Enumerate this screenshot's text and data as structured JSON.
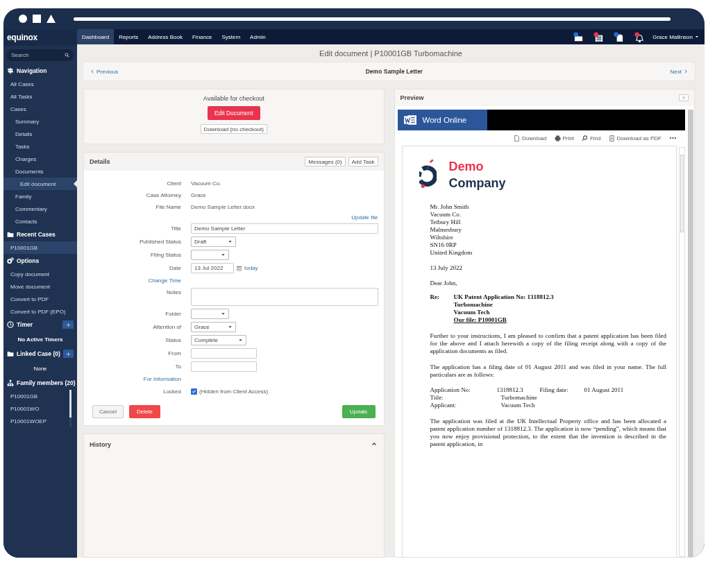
{
  "sidebar": {
    "logo": "equinox",
    "search": {
      "placeholder": "Search"
    },
    "sections": [
      {
        "title": "Navigation",
        "add_button": false,
        "scrollable": false,
        "items": [
          {
            "label": "All Cases",
            "selected": false
          },
          {
            "label": "All Tasks",
            "selected": false
          },
          {
            "label": "Cases",
            "selected": false,
            "children": [
              {
                "label": "Summary",
                "selected": false
              },
              {
                "label": "Details",
                "selected": false
              },
              {
                "label": "Tasks",
                "selected": false
              },
              {
                "label": "Charges",
                "selected": false
              },
              {
                "label": "Documents",
                "selected": false,
                "children": [
                  {
                    "label": "Edit document",
                    "selected": true
                  }
                ]
              },
              {
                "label": "Family",
                "selected": false
              },
              {
                "label": "Commentary",
                "selected": false
              },
              {
                "label": "Contacts",
                "selected": false
              }
            ]
          }
        ]
      },
      {
        "title": "Recent Cases",
        "add_button": false,
        "scrollable": false,
        "items": [
          {
            "label": "P10001GB",
            "selected": true
          }
        ]
      },
      {
        "title": "Options",
        "add_button": false,
        "scrollable": false,
        "items": [
          {
            "label": "Copy document",
            "selected": false
          },
          {
            "label": "Move document",
            "selected": false
          },
          {
            "label": "Convert to PDF",
            "selected": false
          },
          {
            "label": "Convert to PDF (EPO)",
            "selected": false
          }
        ]
      },
      {
        "title": "Timer",
        "add_button": true,
        "scrollable": false,
        "note": "No Active Timers"
      },
      {
        "title": "Linked Case (0)",
        "add_button": true,
        "scrollable": false,
        "note": "None"
      },
      {
        "title": "Family members (20)",
        "add_button": false,
        "scrollable": true,
        "items": [
          {
            "label": "P10001GB",
            "selected": false
          },
          {
            "label": "P10001WO",
            "selected": false
          },
          {
            "label": "P10001WOEP",
            "selected": false
          }
        ]
      }
    ]
  },
  "topnav": {
    "tabs": [
      {
        "label": "Dashboard",
        "selected": true
      },
      {
        "label": "Reports",
        "selected": false
      },
      {
        "label": "Address Book",
        "selected": false
      },
      {
        "label": "Finance",
        "selected": false
      },
      {
        "label": "System",
        "selected": false
      },
      {
        "label": "Admin",
        "selected": false
      }
    ],
    "user": "Grace Mallinson"
  },
  "page_title": "Edit document | P10001GB Turbomachine",
  "pager": {
    "previous": "Previous",
    "title": "Demo Sample Letter",
    "next": "Next"
  },
  "checkout": {
    "status": "Available for checkout",
    "edit_button": "Edit Document",
    "download_button": "Download (no checkout)"
  },
  "details": {
    "title": "Details",
    "header_buttons": [
      "Messages (0)",
      "Add Task"
    ],
    "fields": [
      {
        "kind": "text",
        "label": "Client",
        "value": "Vacuum Co."
      },
      {
        "kind": "text",
        "label": "Case Attorney",
        "value": "Grace"
      },
      {
        "kind": "text",
        "label": "File Name",
        "value": "Demo Sample Letter.docx"
      },
      {
        "kind": "right_link",
        "label": "Update file"
      },
      {
        "kind": "input",
        "label": "Title",
        "value": "Demo Sample Letter"
      },
      {
        "kind": "select",
        "label": "Published Status",
        "value": "Draft"
      },
      {
        "kind": "select",
        "label": "Filing Status"
      },
      {
        "kind": "date",
        "label": "Date",
        "value": "13 Jul 2022",
        "link": "today"
      },
      {
        "kind": "label_link",
        "label": "Change Time"
      },
      {
        "kind": "textarea",
        "label": "Notes"
      },
      {
        "kind": "select",
        "label": "Folder"
      },
      {
        "kind": "select",
        "label": "Attention of",
        "value": "Grace"
      },
      {
        "kind": "select",
        "label": "Status",
        "value": "Complete"
      },
      {
        "kind": "short_input",
        "label": "From"
      },
      {
        "kind": "short_input",
        "label": "To"
      },
      {
        "kind": "label_link",
        "label": "For Information"
      },
      {
        "kind": "checkbox",
        "label": "Locked",
        "checked": true,
        "text": "(Hidden from Client Access)"
      }
    ],
    "actions": {
      "cancel": "Cancel",
      "delete": "Delete",
      "update": "Update"
    }
  },
  "history": {
    "title": "History"
  },
  "preview": {
    "title": "Preview",
    "app_name": "Word Online",
    "toolbar": [
      "Download",
      "Print",
      "Find",
      "Download as PDF"
    ],
    "letter": {
      "logo": {
        "line_1": "Demo",
        "line_2": "Company"
      },
      "address": [
        "Mr. John Smith",
        "Vacuum Co.",
        "Tetbury Hill",
        "Malmesbury",
        "Wiltshire",
        "SN16 0RP",
        "United Kingdom"
      ],
      "date": "13 July 2022",
      "salutation": "Dear John,",
      "re": {
        "label": "Re:",
        "lines": [
          {
            "text": "UK Patent Application No: 1318812.3",
            "underlined": false
          },
          {
            "text": "Turbomachine",
            "underlined": false
          },
          {
            "text": "Vacuum Tech",
            "underlined": false
          },
          {
            "text": "Our file: P10001GB",
            "underlined": true
          }
        ]
      },
      "blocks": [
        {
          "kind": "paragraph",
          "text": "Further to your instructions, I am pleased to confirm that a patent application has been filed for the above and I attach herewith a copy of the filing receipt along with a copy of the application documents as filed."
        },
        {
          "kind": "paragraph",
          "text": "The application has a filing date of 01 August 2011 and was filed in your name. The full particulars are as follows:"
        },
        {
          "kind": "particulars",
          "rows": [
            [
              "Application No:",
              "1318812.3",
              "Filing date:",
              "01 August 2011"
            ],
            [
              "Title:",
              "Turbomachine"
            ],
            [
              "Applicant:",
              "Vacuum Tech"
            ]
          ]
        },
        {
          "kind": "paragraph",
          "text": "The application was filed at the UK Intellectual Property office and has been allocated a patent application number of 1318812.3. The application is now “pending”, which means that you now enjoy provisional protection, to the extent that the invention is described in the patent application, in"
        }
      ]
    }
  }
}
